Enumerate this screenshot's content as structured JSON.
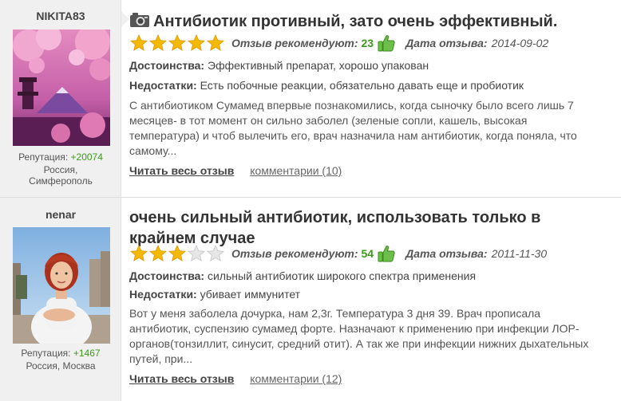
{
  "reviews": [
    {
      "username": "NIKITA83",
      "reputation_label": "Репутация:",
      "reputation_value": "+20074",
      "country": "Россия,",
      "city": "Симферополь",
      "title": "Антибиотик противный, зато очень эффективный.",
      "rating": 5,
      "recommend_label": "Отзыв рекомендуют:",
      "recommend_count": "23",
      "date_label": "Дата отзыва:",
      "date_value": "2014-09-02",
      "pros_label": "Достоинства:",
      "pros_text": "Эффективный препарат, хорошо упакован",
      "cons_label": "Недостатки:",
      "cons_text": "Есть побочные реакции, обязательно давать еще и пробиотик",
      "body": "С антибиотиком Сумамед впервые познакомились, когда сыночку было всего лишь 7 месяцев- в тот момент он сильно заболел (зеленые сопли, кашель, высокая температура) и чтоб вылечить его, врач назначила нам антибиотик, когда поняла, что самому...",
      "read_more": "Читать весь отзыв",
      "comments": "комментарии (10)"
    },
    {
      "username": "nenar",
      "reputation_label": "Репутация:",
      "reputation_value": "+1467",
      "location": "Россия, Москва",
      "title_line1": "очень сильный антибиотик, использовать только в",
      "title_line2": "крайнем случае",
      "rating": 3,
      "recommend_label": "Отзыв рекомендуют:",
      "recommend_count": "54",
      "date_label": "Дата отзыва:",
      "date_value": "2011-11-30",
      "pros_label": "Достоинства:",
      "pros_text": "сильный антибиотик широкого спектра применения",
      "cons_label": "Недостатки:",
      "cons_text": "убивает иммунитет",
      "body": "Вот у меня заболела дочурка, нам 2,3г. Температура 3 дня 39. Врач прописала антибиотик, суспензию сумамед форте. Назначают к применению при инфекции ЛОР-органов(тонзиллит, синусит, средний отит). А так же при инфекции нижних дыхательных путей, при...",
      "read_more": "Читать весь отзыв",
      "comments": "комментарии (12)"
    }
  ],
  "colors": {
    "star_filled": "#f5b800",
    "star_empty": "#d8d8d8",
    "accent_green": "#3a9a1a",
    "sidebar_bg": "#f0f0f0"
  },
  "icons": {
    "title_icon": "camera-icon",
    "like_icon": "thumbs-up-icon"
  }
}
